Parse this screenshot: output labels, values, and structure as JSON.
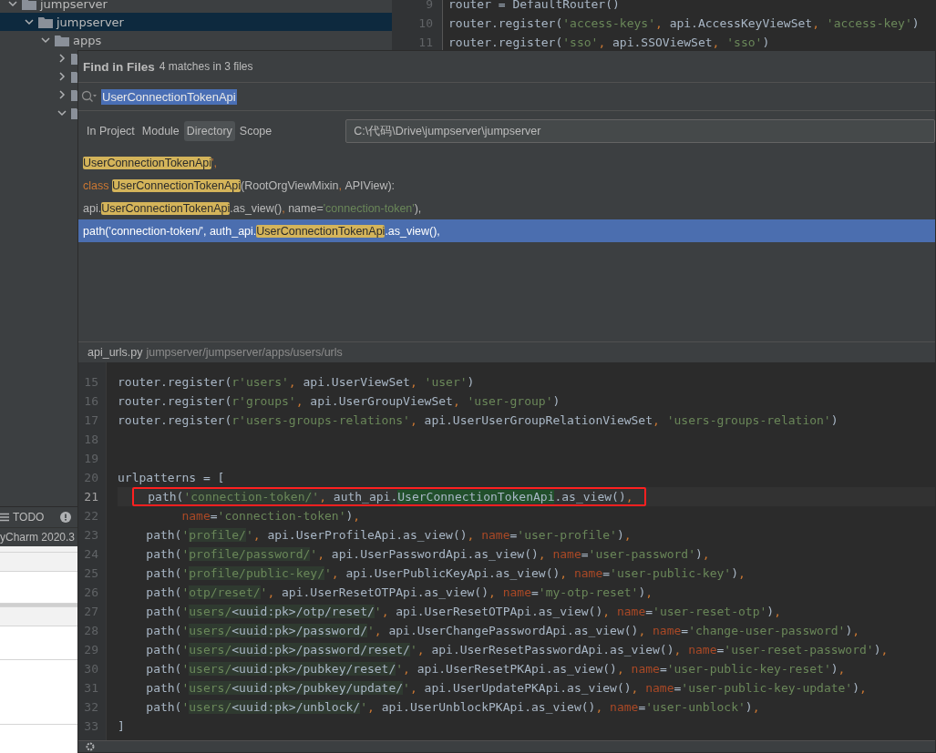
{
  "project_tree": {
    "items": [
      {
        "name": "jumpserver",
        "expanded": true,
        "selected": false,
        "children": [
          {
            "name": "jumpserver",
            "expanded": true,
            "selected": true,
            "children": [
              {
                "name": "apps",
                "expanded": true,
                "selected": false,
                "children": [
                  {
                    "expanded": false,
                    "selected": false
                  },
                  {
                    "expanded": false,
                    "selected": false
                  },
                  {
                    "expanded": false,
                    "selected": false
                  },
                  {
                    "expanded": true,
                    "selected": false
                  }
                ]
              }
            ]
          }
        ]
      }
    ]
  },
  "background_editor": {
    "lines": [
      {
        "number": "9",
        "tokens": [
          {
            "text": "router = DefaultRouter()",
            "kind": "p"
          }
        ]
      },
      {
        "number": "10",
        "tokens": [
          {
            "text": "router.register(",
            "kind": "p"
          },
          {
            "text": "'access-keys'",
            "kind": "s"
          },
          {
            "text": ", ",
            "kind": "c"
          },
          {
            "text": "api.AccessKeyViewSet",
            "kind": "p"
          },
          {
            "text": ", ",
            "kind": "c"
          },
          {
            "text": "'access-key'",
            "kind": "s"
          },
          {
            "text": ")",
            "kind": "p"
          }
        ]
      },
      {
        "number": "11",
        "tokens": [
          {
            "text": "router.register(",
            "kind": "p"
          },
          {
            "text": "'sso'",
            "kind": "s"
          },
          {
            "text": ", ",
            "kind": "c"
          },
          {
            "text": "api.SSOViewSet",
            "kind": "p"
          },
          {
            "text": ", ",
            "kind": "c"
          },
          {
            "text": "'sso'",
            "kind": "s"
          },
          {
            "text": ")",
            "kind": "p"
          }
        ]
      }
    ]
  },
  "tool_window_bar": {
    "items": [
      {
        "label": "TODO"
      }
    ]
  },
  "status_bar": {
    "text": "yCharm 2020.3"
  },
  "find_in_files": {
    "title": "Find in Files",
    "summary": "4 matches in 3 files",
    "search": {
      "value": "UserConnectionTokenApi"
    },
    "scopes": [
      {
        "label": "In Project",
        "selected": false
      },
      {
        "label": "Module",
        "selected": false
      },
      {
        "label": "Directory",
        "selected": true
      },
      {
        "label": "Scope",
        "selected": false
      }
    ],
    "directory": {
      "value": "C:\\代码\\Drive\\jumpserver\\jumpserver"
    },
    "results": [
      {
        "selected": false,
        "tokens": [
          {
            "text": "UserConnectionTokenApi",
            "kind": "m"
          },
          {
            "text": "',",
            "kind": "c"
          }
        ]
      },
      {
        "selected": false,
        "tokens": [
          {
            "text": "class ",
            "kind": "c"
          },
          {
            "text": "UserConnectionTokenApi",
            "kind": "m"
          },
          {
            "text": "(RootOrgViewMixin",
            "kind": "p"
          },
          {
            "text": ", ",
            "kind": "c"
          },
          {
            "text": "APIView):",
            "kind": "p"
          }
        ]
      },
      {
        "selected": false,
        "tokens": [
          {
            "text": "api.",
            "kind": "p"
          },
          {
            "text": "UserConnectionTokenApi",
            "kind": "m"
          },
          {
            "text": ".as_view()",
            "kind": "p"
          },
          {
            "text": ", ",
            "kind": "c"
          },
          {
            "text": "name=",
            "kind": "p"
          },
          {
            "text": "'connection-token'",
            "kind": "s"
          },
          {
            "text": "),",
            "kind": "p"
          }
        ]
      },
      {
        "selected": true,
        "tokens": [
          {
            "text": "path('connection-token/', auth_api.",
            "kind": "p"
          },
          {
            "text": "UserConnectionTokenApi",
            "kind": "m"
          },
          {
            "text": ".as_view(),",
            "kind": "p"
          }
        ]
      }
    ],
    "preview": {
      "file": "api_urls.py",
      "path": "jumpserver/jumpserver/apps/users/urls",
      "lines": [
        {
          "number": "15",
          "current": false,
          "tokens": [
            {
              "text": "router.register(",
              "kind": "p"
            },
            {
              "text": "r'users'",
              "kind": "s"
            },
            {
              "text": ", ",
              "kind": "c"
            },
            {
              "text": "api.UserViewSet",
              "kind": "p"
            },
            {
              "text": ", ",
              "kind": "c"
            },
            {
              "text": "'user'",
              "kind": "s"
            },
            {
              "text": ")",
              "kind": "p"
            }
          ]
        },
        {
          "number": "16",
          "current": false,
          "tokens": [
            {
              "text": "router.register(",
              "kind": "p"
            },
            {
              "text": "r'groups'",
              "kind": "s"
            },
            {
              "text": ", ",
              "kind": "c"
            },
            {
              "text": "api.UserGroupViewSet",
              "kind": "p"
            },
            {
              "text": ", ",
              "kind": "c"
            },
            {
              "text": "'user-group'",
              "kind": "s"
            },
            {
              "text": ")",
              "kind": "p"
            }
          ]
        },
        {
          "number": "17",
          "current": false,
          "tokens": [
            {
              "text": "router.register(",
              "kind": "p"
            },
            {
              "text": "r'users-groups-relations'",
              "kind": "s"
            },
            {
              "text": ", ",
              "kind": "c"
            },
            {
              "text": "api.UserUserGroupRelationViewSet",
              "kind": "p"
            },
            {
              "text": ", ",
              "kind": "c"
            },
            {
              "text": "'users-groups-relation'",
              "kind": "s"
            },
            {
              "text": ")",
              "kind": "p"
            }
          ]
        },
        {
          "number": "18",
          "current": false
        },
        {
          "number": "19",
          "current": false
        },
        {
          "number": "20",
          "current": false,
          "tokens": [
            {
              "text": "urlpatterns = [",
              "kind": "p"
            }
          ]
        },
        {
          "number": "21",
          "current": true,
          "boxed": true,
          "tokens": [
            {
              "text": "  path(",
              "kind": "p"
            },
            {
              "text": "'",
              "kind": "s"
            },
            {
              "text": "connection-token/",
              "kind": "inj"
            },
            {
              "text": "'",
              "kind": "s"
            },
            {
              "text": ", ",
              "kind": "c"
            },
            {
              "text": "auth_api.",
              "kind": "p"
            },
            {
              "text": "UserConnectionTokenApi",
              "kind": "m"
            },
            {
              "text": ".as_view()",
              "kind": "p"
            },
            {
              "text": ",",
              "kind": "c"
            }
          ]
        },
        {
          "number": "22",
          "current": false,
          "tokens": [
            {
              "text": "         name",
              "kind": "param"
            },
            {
              "text": "=",
              "kind": "p"
            },
            {
              "text": "'connection-token'",
              "kind": "s"
            },
            {
              "text": ")",
              "kind": "p"
            },
            {
              "text": ",",
              "kind": "c"
            }
          ]
        },
        {
          "number": "23",
          "current": false,
          "tokens": [
            {
              "text": "    path(",
              "kind": "p"
            },
            {
              "text": "'",
              "kind": "s"
            },
            {
              "text": "profile/",
              "kind": "inj"
            },
            {
              "text": "'",
              "kind": "s"
            },
            {
              "text": ", ",
              "kind": "c"
            },
            {
              "text": "api.UserProfileApi.as_view()",
              "kind": "p"
            },
            {
              "text": ", ",
              "kind": "c"
            },
            {
              "text": "name",
              "kind": "param"
            },
            {
              "text": "=",
              "kind": "p"
            },
            {
              "text": "'user-profile'",
              "kind": "s"
            },
            {
              "text": ")",
              "kind": "p"
            },
            {
              "text": ",",
              "kind": "c"
            }
          ]
        },
        {
          "number": "24",
          "current": false,
          "tokens": [
            {
              "text": "    path(",
              "kind": "p"
            },
            {
              "text": "'",
              "kind": "s"
            },
            {
              "text": "profile/password/",
              "kind": "inj"
            },
            {
              "text": "'",
              "kind": "s"
            },
            {
              "text": ", ",
              "kind": "c"
            },
            {
              "text": "api.UserPasswordApi.as_view()",
              "kind": "p"
            },
            {
              "text": ", ",
              "kind": "c"
            },
            {
              "text": "name",
              "kind": "param"
            },
            {
              "text": "=",
              "kind": "p"
            },
            {
              "text": "'user-password'",
              "kind": "s"
            },
            {
              "text": ")",
              "kind": "p"
            },
            {
              "text": ",",
              "kind": "c"
            }
          ]
        },
        {
          "number": "25",
          "current": false,
          "tokens": [
            {
              "text": "    path(",
              "kind": "p"
            },
            {
              "text": "'",
              "kind": "s"
            },
            {
              "text": "profile/public-key/",
              "kind": "inj"
            },
            {
              "text": "'",
              "kind": "s"
            },
            {
              "text": ", ",
              "kind": "c"
            },
            {
              "text": "api.UserPublicKeyApi.as_view()",
              "kind": "p"
            },
            {
              "text": ", ",
              "kind": "c"
            },
            {
              "text": "name",
              "kind": "param"
            },
            {
              "text": "=",
              "kind": "p"
            },
            {
              "text": "'user-public-key'",
              "kind": "s"
            },
            {
              "text": ")",
              "kind": "p"
            },
            {
              "text": ",",
              "kind": "c"
            }
          ]
        },
        {
          "number": "26",
          "current": false,
          "tokens": [
            {
              "text": "    path(",
              "kind": "p"
            },
            {
              "text": "'",
              "kind": "s"
            },
            {
              "text": "otp/reset/",
              "kind": "inj"
            },
            {
              "text": "'",
              "kind": "s"
            },
            {
              "text": ", ",
              "kind": "c"
            },
            {
              "text": "api.UserResetOTPApi.as_view()",
              "kind": "p"
            },
            {
              "text": ", ",
              "kind": "c"
            },
            {
              "text": "name",
              "kind": "param"
            },
            {
              "text": "=",
              "kind": "p"
            },
            {
              "text": "'my-otp-reset'",
              "kind": "s"
            },
            {
              "text": ")",
              "kind": "p"
            },
            {
              "text": ",",
              "kind": "c"
            }
          ]
        },
        {
          "number": "27",
          "current": false,
          "tokens": [
            {
              "text": "    path(",
              "kind": "p"
            },
            {
              "text": "'",
              "kind": "s"
            },
            {
              "text": "users/",
              "kind": "inj"
            },
            {
              "text": "<uuid:pk>/otp/reset/",
              "kind": "injp"
            },
            {
              "text": "'",
              "kind": "s"
            },
            {
              "text": ", ",
              "kind": "c"
            },
            {
              "text": "api.UserResetOTPApi.as_view()",
              "kind": "p"
            },
            {
              "text": ", ",
              "kind": "c"
            },
            {
              "text": "name",
              "kind": "param"
            },
            {
              "text": "=",
              "kind": "p"
            },
            {
              "text": "'user-reset-otp'",
              "kind": "s"
            },
            {
              "text": ")",
              "kind": "p"
            },
            {
              "text": ",",
              "kind": "c"
            }
          ]
        },
        {
          "number": "28",
          "current": false,
          "tokens": [
            {
              "text": "    path(",
              "kind": "p"
            },
            {
              "text": "'",
              "kind": "s"
            },
            {
              "text": "users/",
              "kind": "inj"
            },
            {
              "text": "<uuid:pk>/password/",
              "kind": "injp"
            },
            {
              "text": "'",
              "kind": "s"
            },
            {
              "text": ", ",
              "kind": "c"
            },
            {
              "text": "api.UserChangePasswordApi.as_view()",
              "kind": "p"
            },
            {
              "text": ", ",
              "kind": "c"
            },
            {
              "text": "name",
              "kind": "param"
            },
            {
              "text": "=",
              "kind": "p"
            },
            {
              "text": "'change-user-password'",
              "kind": "s"
            },
            {
              "text": ")",
              "kind": "p"
            },
            {
              "text": ",",
              "kind": "c"
            }
          ]
        },
        {
          "number": "29",
          "current": false,
          "tokens": [
            {
              "text": "    path(",
              "kind": "p"
            },
            {
              "text": "'",
              "kind": "s"
            },
            {
              "text": "users/",
              "kind": "inj"
            },
            {
              "text": "<uuid:pk>/password/reset/",
              "kind": "injp"
            },
            {
              "text": "'",
              "kind": "s"
            },
            {
              "text": ", ",
              "kind": "c"
            },
            {
              "text": "api.UserResetPasswordApi.as_view()",
              "kind": "p"
            },
            {
              "text": ", ",
              "kind": "c"
            },
            {
              "text": "name",
              "kind": "param"
            },
            {
              "text": "=",
              "kind": "p"
            },
            {
              "text": "'user-reset-password'",
              "kind": "s"
            },
            {
              "text": ")",
              "kind": "p"
            },
            {
              "text": ",",
              "kind": "c"
            }
          ]
        },
        {
          "number": "30",
          "current": false,
          "tokens": [
            {
              "text": "    path(",
              "kind": "p"
            },
            {
              "text": "'",
              "kind": "s"
            },
            {
              "text": "users/",
              "kind": "inj"
            },
            {
              "text": "<uuid:pk>/pubkey/reset/",
              "kind": "injp"
            },
            {
              "text": "'",
              "kind": "s"
            },
            {
              "text": ", ",
              "kind": "c"
            },
            {
              "text": "api.UserResetPKApi.as_view()",
              "kind": "p"
            },
            {
              "text": ", ",
              "kind": "c"
            },
            {
              "text": "name",
              "kind": "param"
            },
            {
              "text": "=",
              "kind": "p"
            },
            {
              "text": "'user-public-key-reset'",
              "kind": "s"
            },
            {
              "text": ")",
              "kind": "p"
            },
            {
              "text": ",",
              "kind": "c"
            }
          ]
        },
        {
          "number": "31",
          "current": false,
          "tokens": [
            {
              "text": "    path(",
              "kind": "p"
            },
            {
              "text": "'",
              "kind": "s"
            },
            {
              "text": "users/",
              "kind": "inj"
            },
            {
              "text": "<uuid:pk>/pubkey/update/",
              "kind": "injp"
            },
            {
              "text": "'",
              "kind": "s"
            },
            {
              "text": ", ",
              "kind": "c"
            },
            {
              "text": "api.UserUpdatePKApi.as_view()",
              "kind": "p"
            },
            {
              "text": ", ",
              "kind": "c"
            },
            {
              "text": "name",
              "kind": "param"
            },
            {
              "text": "=",
              "kind": "p"
            },
            {
              "text": "'user-public-key-update'",
              "kind": "s"
            },
            {
              "text": ")",
              "kind": "p"
            },
            {
              "text": ",",
              "kind": "c"
            }
          ]
        },
        {
          "number": "32",
          "current": false,
          "tokens": [
            {
              "text": "    path(",
              "kind": "p"
            },
            {
              "text": "'",
              "kind": "s"
            },
            {
              "text": "users/",
              "kind": "inj"
            },
            {
              "text": "<uuid:pk>/unblock/",
              "kind": "injp"
            },
            {
              "text": "'",
              "kind": "s"
            },
            {
              "text": ", ",
              "kind": "c"
            },
            {
              "text": "api.UserUnblockPKApi.as_view()",
              "kind": "p"
            },
            {
              "text": ", ",
              "kind": "c"
            },
            {
              "text": "name",
              "kind": "param"
            },
            {
              "text": "=",
              "kind": "p"
            },
            {
              "text": "'user-unblock'",
              "kind": "s"
            },
            {
              "text": ")",
              "kind": "p"
            },
            {
              "text": ",",
              "kind": "c"
            }
          ]
        },
        {
          "number": "33",
          "current": false,
          "tokens": [
            {
              "text": "]",
              "kind": "p"
            }
          ]
        }
      ]
    }
  }
}
